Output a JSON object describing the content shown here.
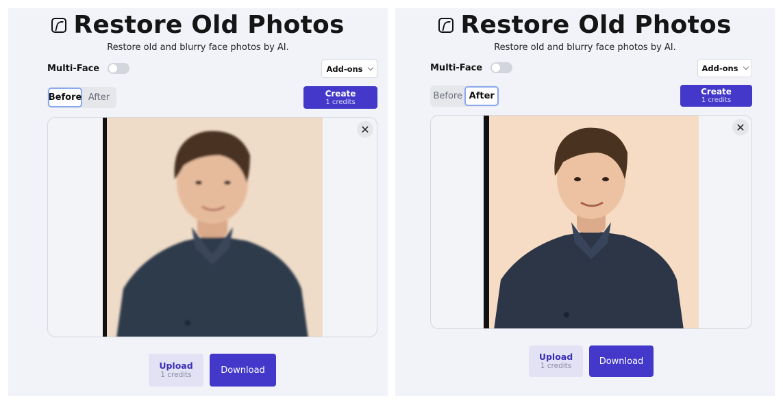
{
  "panels": [
    {
      "title": "Restore Old Photos",
      "subtitle": "Restore old and blurry face photos by AI.",
      "multi_face_label": "Multi-Face",
      "multi_face_on": false,
      "addons_label": "Add-ons",
      "tabs": [
        {
          "label": "Before",
          "active": true
        },
        {
          "label": "After",
          "active": false
        }
      ],
      "create": {
        "label": "Create",
        "credits": "1 credits"
      },
      "close_glyph": "✕",
      "upload": {
        "label": "Upload",
        "credits": "1 credits"
      },
      "download_label": "Download",
      "image_state": "before-blurry"
    },
    {
      "title": "Restore Old Photos",
      "subtitle": "Restore old and blurry face photos by AI.",
      "multi_face_label": "Multi-Face",
      "multi_face_on": false,
      "addons_label": "Add-ons",
      "tabs": [
        {
          "label": "Before",
          "active": false
        },
        {
          "label": "After",
          "active": true
        }
      ],
      "create": {
        "label": "Create",
        "credits": "1 credits"
      },
      "close_glyph": "✕",
      "upload": {
        "label": "Upload",
        "credits": "1 credits"
      },
      "download_label": "Download",
      "image_state": "after-restored"
    }
  ],
  "colors": {
    "accent": "#4338ca",
    "panel_bg": "#f1f3f8",
    "upload_bg": "#e3e2f5",
    "photo_bg_before": "#efdcc8",
    "photo_bg_after": "#f6dcc4",
    "shirt": "#2f3a4c",
    "hair": "#4a3221",
    "skin": "#e6bb9c"
  }
}
